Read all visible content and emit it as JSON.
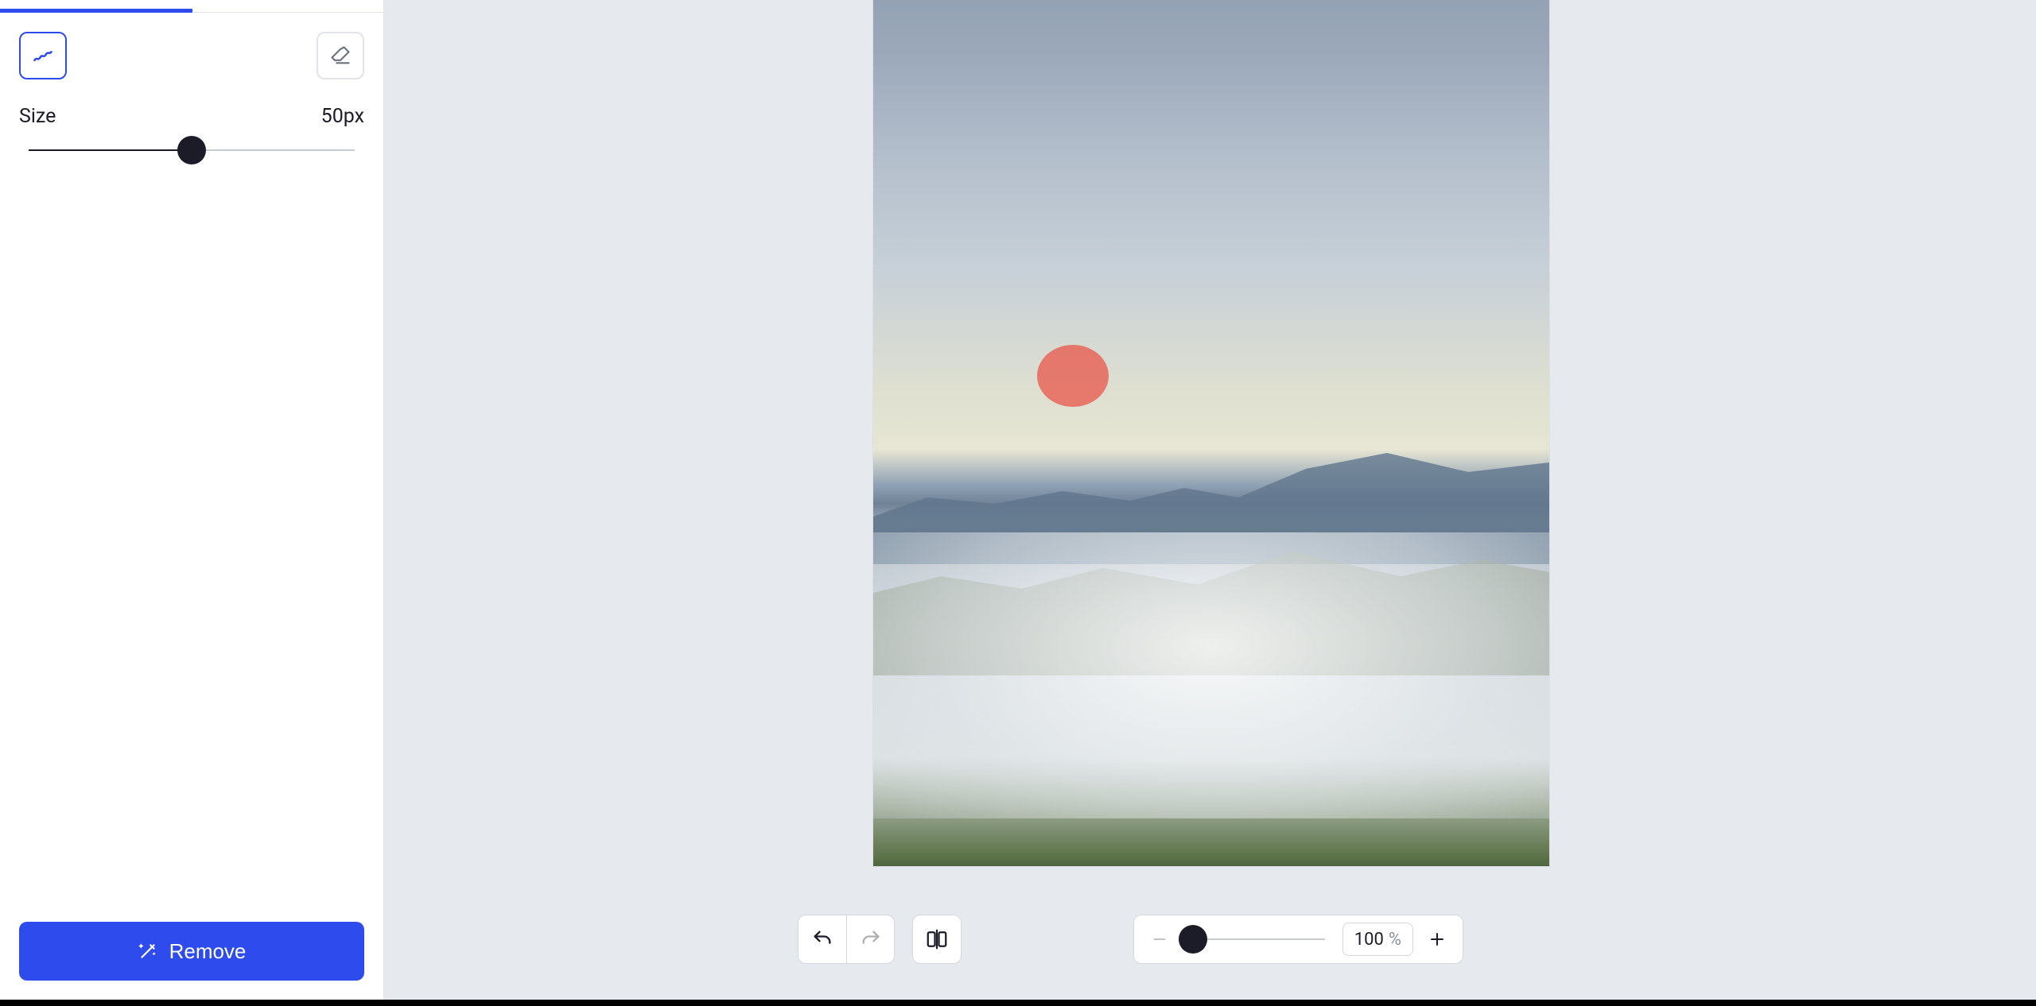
{
  "sidebar": {
    "tabs_count": 2,
    "active_tab_index": 0,
    "tools": {
      "brush_active": true,
      "eraser_active": false
    },
    "size": {
      "label": "Size",
      "value": 50,
      "unit": "px",
      "min": 1,
      "max": 100,
      "display": "50px",
      "percent": 50
    },
    "remove_label": "Remove"
  },
  "canvas": {
    "image_description": "mountain-landscape-with-clouds",
    "brush_mark_color": "#e85b4f"
  },
  "bottombar": {
    "undo_enabled": true,
    "redo_enabled": false,
    "zoom": {
      "value": 100,
      "unit": "%",
      "display_value": "100",
      "display_unit": "%",
      "min": 10,
      "max": 400,
      "slider_percent": 8,
      "minus_enabled": false,
      "plus_enabled": true
    }
  },
  "colors": {
    "accent": "#2E4CED",
    "marker": "#e85b4f"
  }
}
